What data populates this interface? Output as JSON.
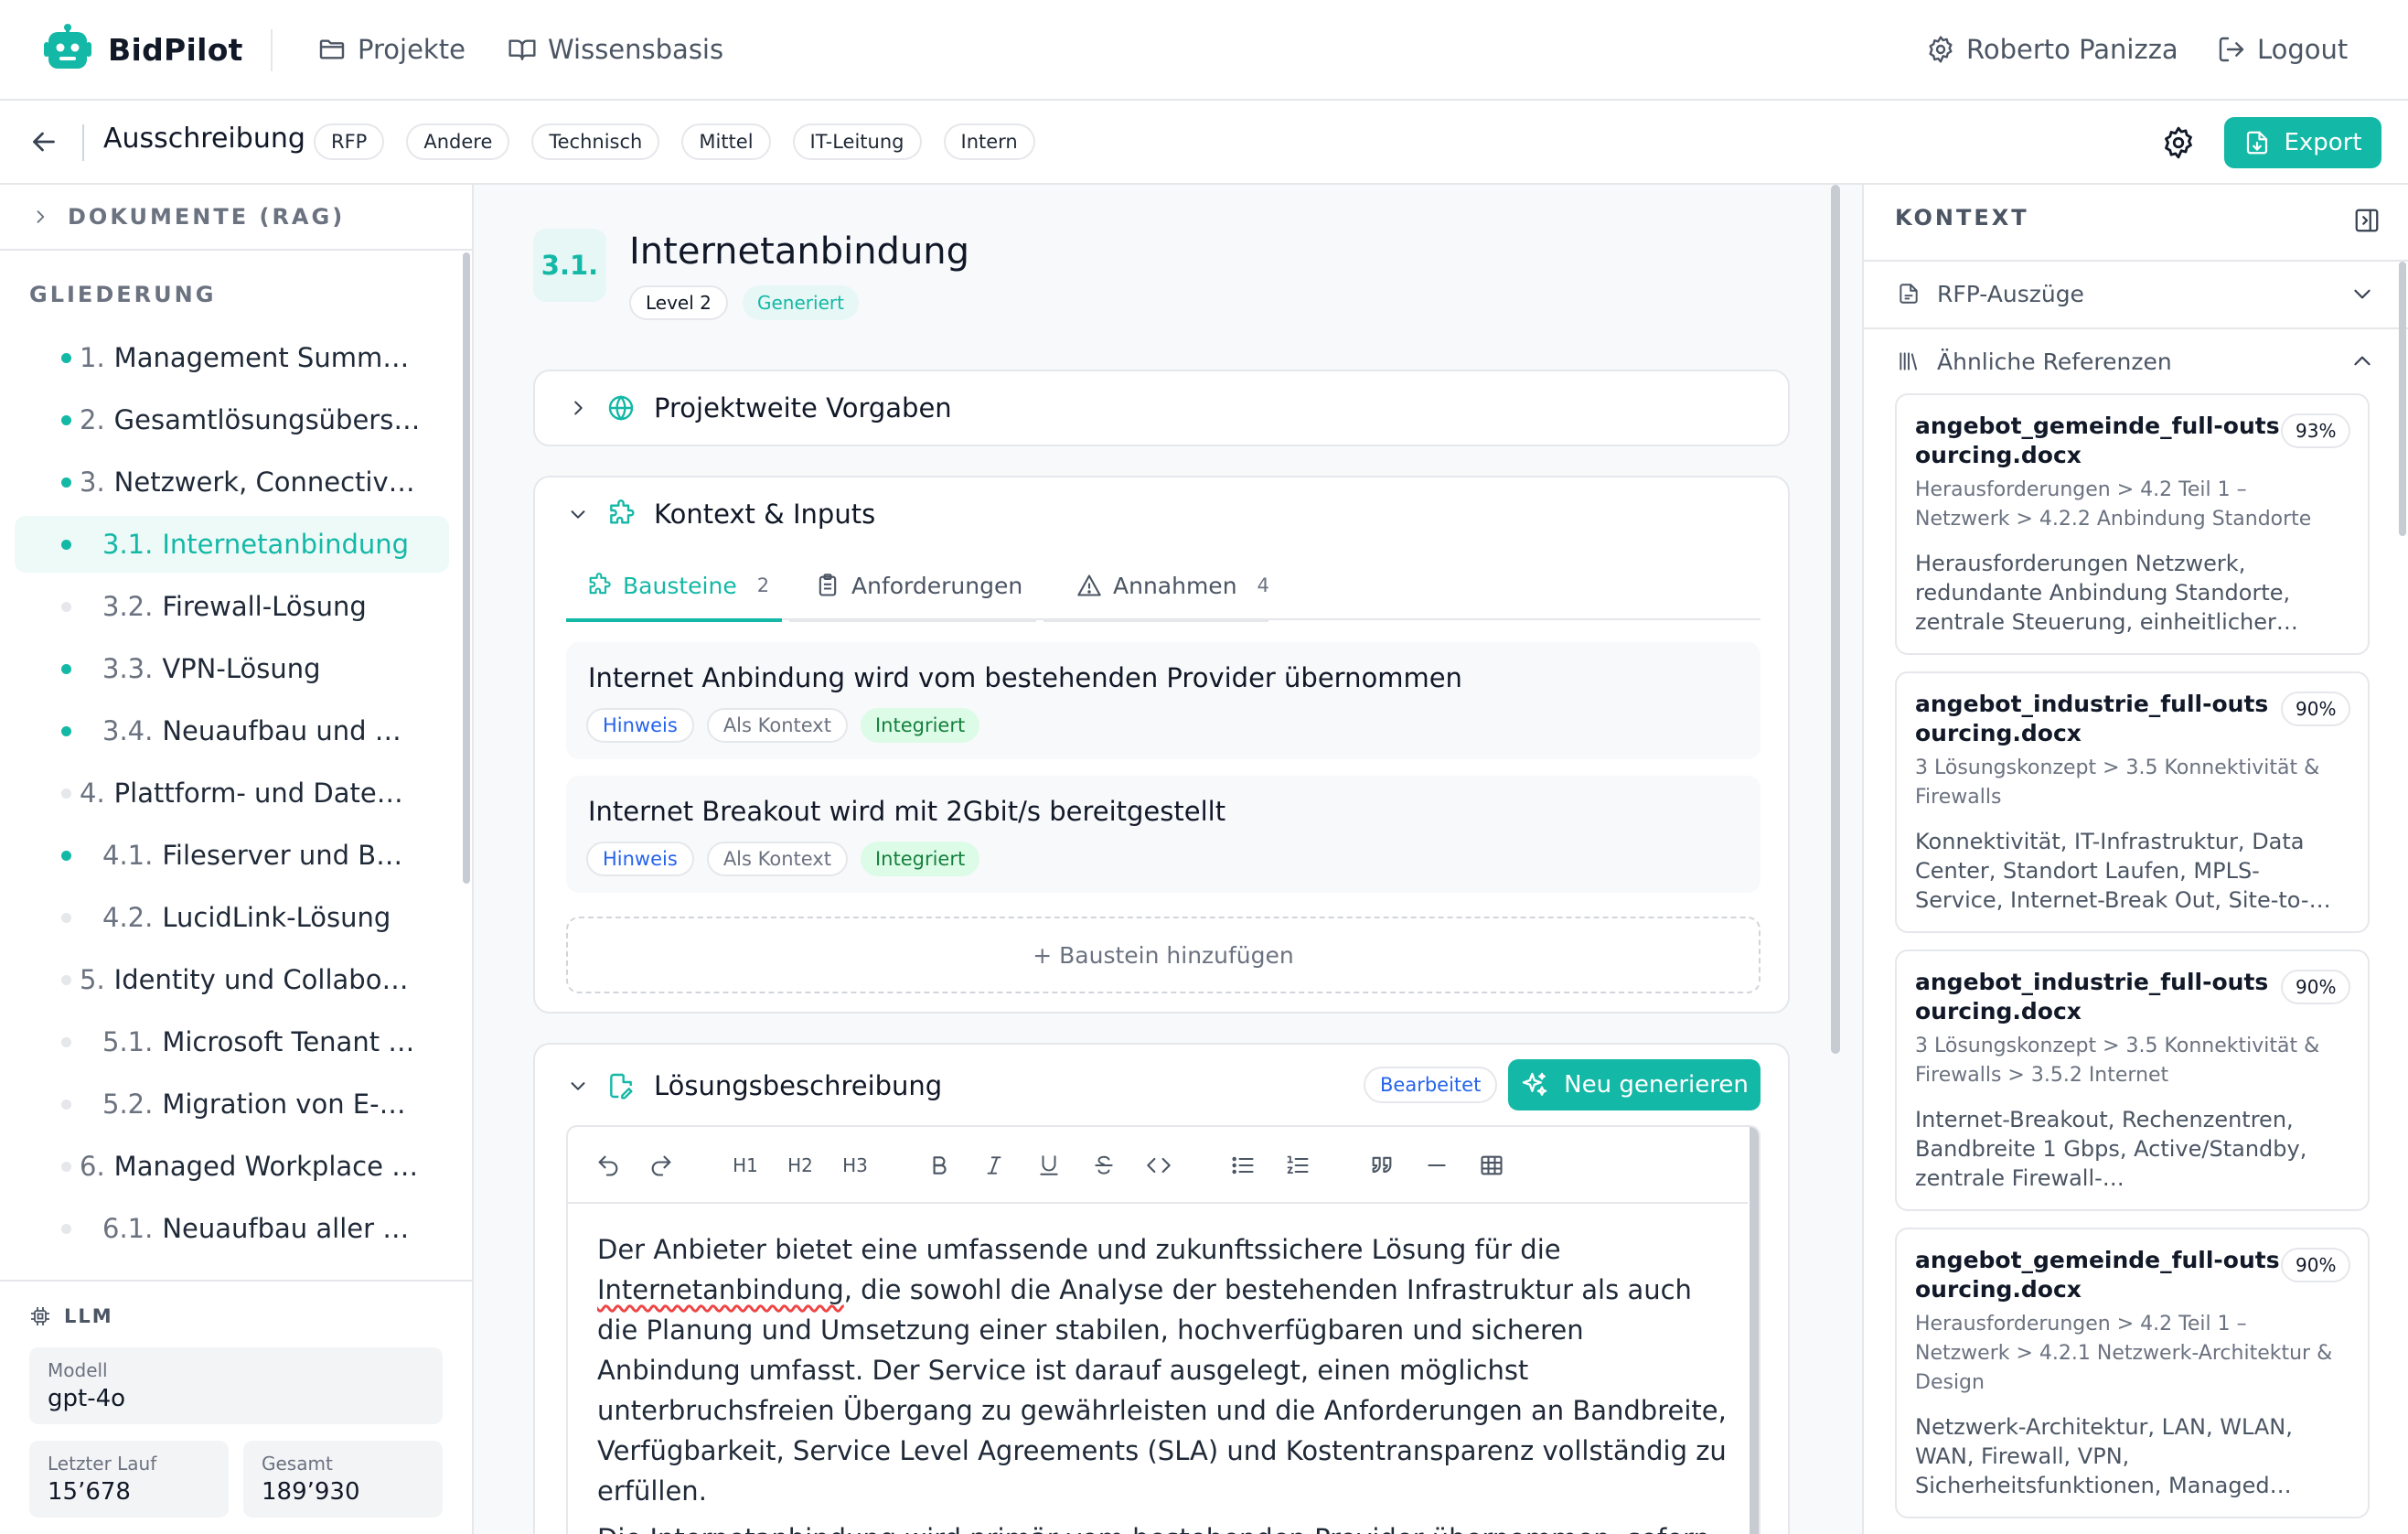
{
  "header": {
    "brand": "BidPilot",
    "nav": [
      {
        "label": "Projekte",
        "icon": "folder-icon"
      },
      {
        "label": "Wissensbasis",
        "icon": "book-icon"
      }
    ],
    "user": {
      "name": "Roberto Panizza",
      "icon": "gear-icon"
    },
    "logout": {
      "label": "Logout",
      "icon": "logout-icon"
    }
  },
  "subheader": {
    "title": "Ausschreibung",
    "tags": [
      "RFP",
      "Andere",
      "Technisch",
      "Mittel",
      "IT-Leitung",
      "Intern"
    ],
    "export_label": "Export"
  },
  "sidebar": {
    "documents_label": "DOKUMENTE (RAG)",
    "outline_label": "GLIEDERUNG",
    "items": [
      {
        "num": "1.",
        "title": "Management Summ…",
        "level": 1,
        "dot": true
      },
      {
        "num": "2.",
        "title": "Gesamtlösungsübers…",
        "level": 1,
        "dot": true
      },
      {
        "num": "3.",
        "title": "Netzwerk, Connectiv…",
        "level": 1,
        "dot": true
      },
      {
        "num": "3.1.",
        "title": "Internetanbindung",
        "level": 2,
        "dot": true,
        "active": true
      },
      {
        "num": "3.2.",
        "title": "Firewall-Lösung",
        "level": 2,
        "dot": false
      },
      {
        "num": "3.3.",
        "title": "VPN-Lösung",
        "level": 2,
        "dot": true
      },
      {
        "num": "3.4.",
        "title": "Neuaufbau und …",
        "level": 2,
        "dot": true
      },
      {
        "num": "4.",
        "title": "Plattform- und Date…",
        "level": 1,
        "dot": false
      },
      {
        "num": "4.1.",
        "title": "Fileserver und B…",
        "level": 2,
        "dot": true
      },
      {
        "num": "4.2.",
        "title": "LucidLink-Lösung",
        "level": 2,
        "dot": false
      },
      {
        "num": "5.",
        "title": "Identity und Collabo…",
        "level": 1,
        "dot": false
      },
      {
        "num": "5.1.",
        "title": "Microsoft Tenant …",
        "level": 2,
        "dot": false
      },
      {
        "num": "5.2.",
        "title": "Migration von E-…",
        "level": 2,
        "dot": false
      },
      {
        "num": "6.",
        "title": "Managed Workplace …",
        "level": 1,
        "dot": false
      },
      {
        "num": "6.1.",
        "title": "Neuaufbau aller …",
        "level": 2,
        "dot": false
      }
    ],
    "llm": {
      "label": "LLM",
      "model_label": "Modell",
      "model": "gpt-4o",
      "last_run_label": "Letzter Lauf",
      "last_run": "15’678",
      "total_label": "Gesamt",
      "total": "189’930"
    }
  },
  "section": {
    "number": "3.1.",
    "title": "Internetanbindung",
    "level": "Level 2",
    "status": "Generiert",
    "project_defaults_label": "Projektweite Vorgaben",
    "context_label": "Kontext & Inputs",
    "tabs": [
      {
        "label": "Bausteine",
        "count": "2"
      },
      {
        "label": "Anforderungen",
        "count": ""
      },
      {
        "label": "Annahmen",
        "count": "4"
      }
    ],
    "bausteine": [
      {
        "text": "Internet Anbindung wird vom bestehenden Provider übernommen",
        "tags": [
          "Hinweis",
          "Als Kontext",
          "Integriert"
        ]
      },
      {
        "text": "Internet Breakout wird mit 2Gbit/s bereitgestellt",
        "tags": [
          "Hinweis",
          "Als Kontext",
          "Integriert"
        ]
      }
    ],
    "add_baustein": "+ Baustein hinzufügen",
    "solution_label": "Lösungsbeschreibung",
    "edited_badge": "Bearbeitet",
    "regenerate_label": "Neu generieren",
    "toolbar": {
      "h1": "H1",
      "h2": "H2",
      "h3": "H3"
    },
    "editor": {
      "p1_a": "Der Anbieter bietet eine umfassende und zukunftssichere Lösung für die ",
      "p1_spell": "Internetanbindung",
      "p1_b": ", die sowohl die Analyse der bestehenden Infrastruktur als auch die Planung und Umsetzung einer stabilen, hochverfügbaren und sicheren Anbindung umfasst. Der Service ist darauf ausgelegt, einen möglichst unterbruchsfreien Übergang zu gewährleisten und die Anforderungen an Bandbreite, Verfügbarkeit, Service Level Agreements (SLA) und Kostentransparenz vollständig zu erfüllen.",
      "p2": "Die Internetanbindung wird primär vom bestehenden Provider übernommen, sofern"
    }
  },
  "context": {
    "title": "KONTEXT",
    "rfp_label": "RFP-Auszüge",
    "refs_label": "Ähnliche Referenzen",
    "references": [
      {
        "name": "angebot_gemeinde_full-outsourcing.docx",
        "score": "93%",
        "path": "Herausforderungen > 4.2 Teil 1 – Netzwerk > 4.2.2 Anbindung Standorte",
        "snippet": "Herausforderungen Netzwerk, redundante Anbindung Standorte, zentrale Steuerung, einheitlicher…"
      },
      {
        "name": "angebot_industrie_full-outsourcing.docx",
        "score": "90%",
        "path": "3 Lösungskonzept > 3.5 Konnektivität & Firewalls",
        "snippet": "Konnektivität, IT-Infrastruktur, Data Center, Standort Laufen, MPLS-Service, Internet-Break Out, Site-to-…"
      },
      {
        "name": "angebot_industrie_full-outsourcing.docx",
        "score": "90%",
        "path": "3 Lösungskonzept > 3.5 Konnektivität & Firewalls > 3.5.2 Internet",
        "snippet": "Internet-Breakout, Rechenzentren, Bandbreite 1 Gbps, Active/Standby, zentrale Firewall-…"
      },
      {
        "name": "angebot_gemeinde_full-outsourcing.docx",
        "score": "90%",
        "path": "Herausforderungen > 4.2 Teil 1 – Netzwerk > 4.2.1 Netzwerk-Architektur & Design",
        "snippet": "Netzwerk-Architektur, LAN, WLAN, WAN, Firewall, VPN, Sicherheitsfunktionen, Managed…"
      }
    ]
  },
  "colors": {
    "accent": "#14b8a6",
    "hint": "#2563eb",
    "integrated_bg": "#dcfce7",
    "integrated_text": "#15803d"
  }
}
